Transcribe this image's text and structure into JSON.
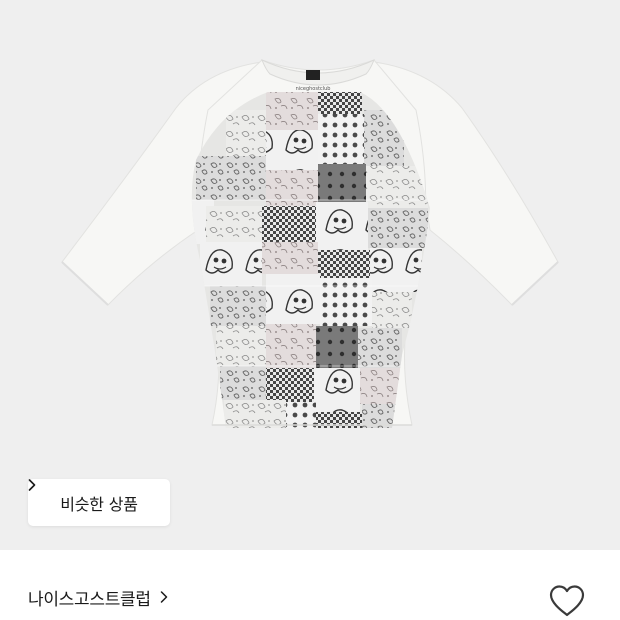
{
  "product": {
    "image_alt": "patchwork raglan t-shirt",
    "similar_button_label": "비슷한 상품",
    "brand_name": "나이스고스트클럽",
    "wishlisted": false
  },
  "icons": {
    "similar_chevron": "chevron-right-icon",
    "brand_chevron": "chevron-right-icon",
    "wishlist": "heart-outline-icon"
  },
  "colors": {
    "image_background": "#efefef",
    "shirt": "#f7f7f5",
    "text": "#1a1a1a",
    "icon": "#3a3a3a"
  }
}
